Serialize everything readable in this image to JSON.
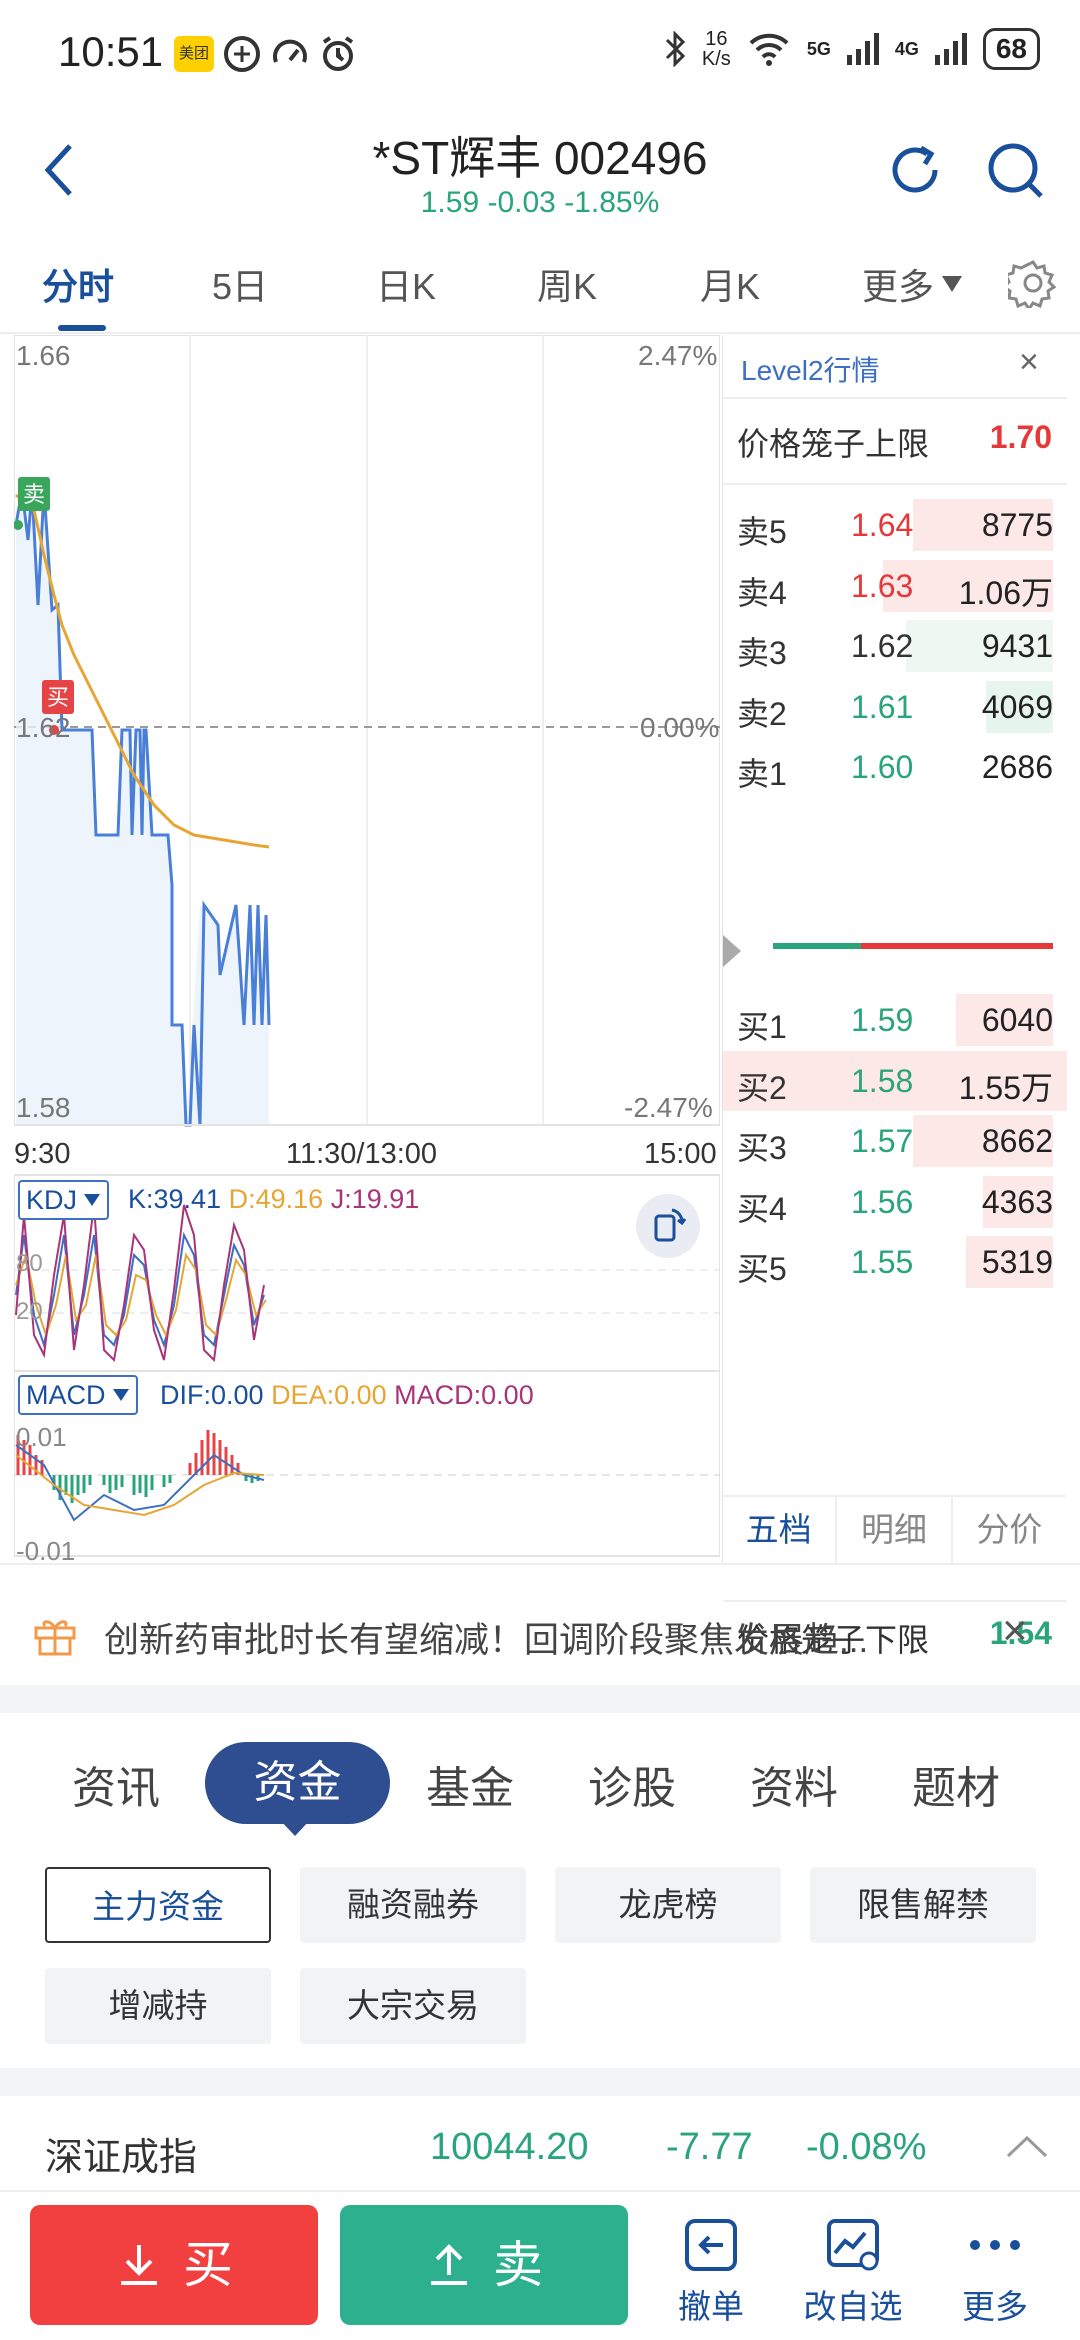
{
  "status_bar": {
    "time": "10:51",
    "app_badge": "美团",
    "net_speed_top": "16",
    "net_speed_bottom": "K/s",
    "signal_5g": "5G",
    "signal_4g": "4G",
    "battery": "68"
  },
  "header": {
    "title": "*ST辉丰 002496",
    "price": "1.59",
    "change": "-0.03",
    "change_pct": "-1.85%"
  },
  "tabs": [
    "分时",
    "5日",
    "日K",
    "周K",
    "月K",
    "更多"
  ],
  "chart": {
    "price_high": "1.66",
    "price_low": "1.58",
    "price_mid": "1.62",
    "pct_high": "2.47%",
    "pct_mid": "0.00%",
    "pct_low": "-2.47%",
    "time_start": "9:30",
    "time_mid": "11:30/13:00",
    "time_end": "15:00",
    "sell_marker": "卖",
    "buy_marker": "买"
  },
  "kdj": {
    "name": "KDJ",
    "k": "K:39.41",
    "d": "D:49.16",
    "j": "J:19.91",
    "lvl_80": "80",
    "lvl_20": "20"
  },
  "macd": {
    "name": "MACD",
    "dif": "DIF:0.00",
    "dea": "DEA:0.00",
    "macd": "MACD:0.00",
    "top": "0.01",
    "bottom": "-0.01"
  },
  "level2": {
    "title": "Level2行情",
    "close": "×",
    "upper_limit_label": "价格笼子上限",
    "upper_limit": "1.70",
    "asks": [
      {
        "label": "卖5",
        "price": "1.64",
        "vol": "8775",
        "bar": 0.56,
        "color": "red"
      },
      {
        "label": "卖4",
        "price": "1.63",
        "vol": "1.06万",
        "bar": 0.68,
        "color": "red"
      },
      {
        "label": "卖3",
        "price": "1.62",
        "vol": "9431",
        "bar": 0.59,
        "color": "neutral"
      },
      {
        "label": "卖2",
        "price": "1.61",
        "vol": "4069",
        "bar": 0.27,
        "color": "grn"
      },
      {
        "label": "卖1",
        "price": "1.60",
        "vol": "2686",
        "bar": 0.0,
        "color": "grn"
      }
    ],
    "bids": [
      {
        "label": "买1",
        "price": "1.59",
        "vol": "6040",
        "bar": 0.39,
        "color": "grn"
      },
      {
        "label": "买2",
        "price": "1.58",
        "vol": "1.55万",
        "bar": 1.0,
        "color": "grn"
      },
      {
        "label": "买3",
        "price": "1.57",
        "vol": "8662",
        "bar": 0.56,
        "color": "grn"
      },
      {
        "label": "买4",
        "price": "1.56",
        "vol": "4363",
        "bar": 0.28,
        "color": "grn"
      },
      {
        "label": "买5",
        "price": "1.55",
        "vol": "5319",
        "bar": 0.35,
        "color": "grn"
      }
    ],
    "lower_limit_label": "价格笼子下限",
    "lower_limit": "1.54",
    "tabs": [
      "五档",
      "明细",
      "分价"
    ]
  },
  "news": {
    "text": "创新药审批时长有望缩减！回调阶段聚焦发展趋...",
    "close": "×"
  },
  "categories": [
    "资讯",
    "资金",
    "基金",
    "诊股",
    "资料",
    "题材"
  ],
  "chips": [
    "主力资金",
    "融资融券",
    "龙虎榜",
    "限售解禁",
    "增减持",
    "大宗交易"
  ],
  "index": {
    "name": "深证成指",
    "value": "10044.20",
    "change": "-7.77",
    "pct": "-0.08%"
  },
  "bottom": {
    "buy": "买",
    "sell": "卖",
    "cancel": "撤单",
    "watchlist": "改自选",
    "more": "更多"
  },
  "colors": {
    "accent": "#1a4f9c",
    "red": "#e63838",
    "green": "#2aa57a"
  }
}
